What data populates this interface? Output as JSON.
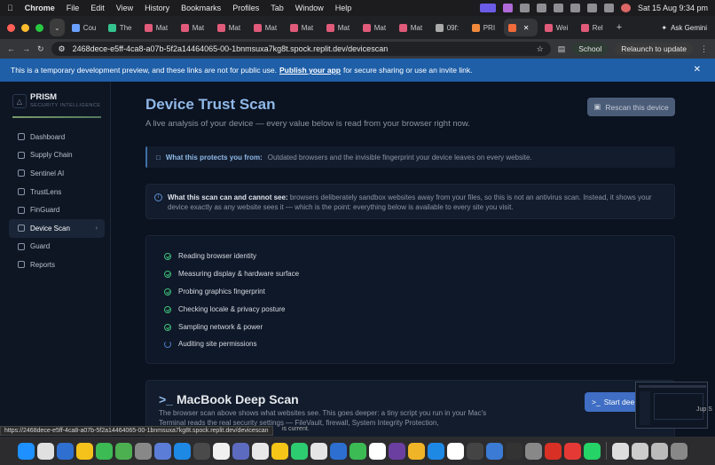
{
  "menubar": {
    "app": "Chrome",
    "items": [
      "File",
      "Edit",
      "View",
      "History",
      "Bookmarks",
      "Profiles",
      "Tab",
      "Window",
      "Help"
    ],
    "datetime": "Sat 15 Aug  9:34 pm"
  },
  "tabs": [
    {
      "label": "Cou",
      "color": "#6aa0ff"
    },
    {
      "label": "The",
      "color": "#34c38f"
    },
    {
      "label": "Mat",
      "color": "#e05a7a"
    },
    {
      "label": "Mat",
      "color": "#e05a7a"
    },
    {
      "label": "Mat",
      "color": "#e05a7a"
    },
    {
      "label": "Mat",
      "color": "#e05a7a"
    },
    {
      "label": "Mat",
      "color": "#e05a7a"
    },
    {
      "label": "Mat",
      "color": "#e05a7a"
    },
    {
      "label": "Mat",
      "color": "#e05a7a"
    },
    {
      "label": "Mat",
      "color": "#e05a7a"
    },
    {
      "label": "09f:",
      "color": "#aaaaaa"
    },
    {
      "label": "PRI",
      "color": "#f08a3c"
    },
    {
      "label": "",
      "color": "#f26b3a",
      "active": true
    },
    {
      "label": "Wei",
      "color": "#e05a7a"
    },
    {
      "label": "Rel",
      "color": "#e05a7a"
    }
  ],
  "ask_gemini": "Ask Gemini",
  "address": {
    "url": "2468dece-e5ff-4ca8-a07b-5f2a14464065-00-1bnmsuxa7kg8t.spock.replit.dev/devicescan",
    "profile": "School",
    "relaunch": "Relaunch to update"
  },
  "banner": {
    "text_before": "This is a temporary development preview, and these links are not for public use.",
    "link": "Publish your app",
    "text_after": "for secure sharing or use an invite link."
  },
  "brand": {
    "name": "PRISM",
    "tagline": "SECURITY INTELLIGENCE"
  },
  "nav": [
    "Dashboard",
    "Supply Chain",
    "Sentinel AI",
    "TrustLens",
    "FinGuard",
    "Device Scan",
    "Guard",
    "Reports"
  ],
  "page": {
    "title": "Device Trust Scan",
    "subtitle": "A live analysis of your device — every value below is read from your browser right now.",
    "rescan": "Rescan this device",
    "protect_label": "What this protects you from:",
    "protect_text": "Outdated browsers and the invisible fingerprint your device leaves on every website.",
    "notice_label": "What this scan can and cannot see:",
    "notice_text": "browsers deliberately sandbox websites away from your files, so this is not an antivirus scan. Instead, it shows your device exactly as any website sees it — which is the point: everything below is available to every site you visit.",
    "steps": [
      {
        "label": "Reading browser identity",
        "status": "done"
      },
      {
        "label": "Measuring display & hardware surface",
        "status": "done"
      },
      {
        "label": "Probing graphics fingerprint",
        "status": "done"
      },
      {
        "label": "Checking locale & privacy posture",
        "status": "done"
      },
      {
        "label": "Sampling network & power",
        "status": "done"
      },
      {
        "label": "Auditing site permissions",
        "status": "running"
      }
    ],
    "deep_title": "MacBook Deep Scan",
    "deep_text": "The browser scan above shows what websites see. This goes deeper: a tiny script you run in your Mac's Terminal reads the real security settings — FileVault, firewall, System Integrity Protection,",
    "start": "Start dee"
  },
  "status_url": "https://2468dece-e5ff-4ca8-a07b-5f2a14464065-00-1bnmsuxa7kg8t.spock.replit.dev/devicescan",
  "behind_text": "is current.",
  "behind_text2": "Jup S"
}
